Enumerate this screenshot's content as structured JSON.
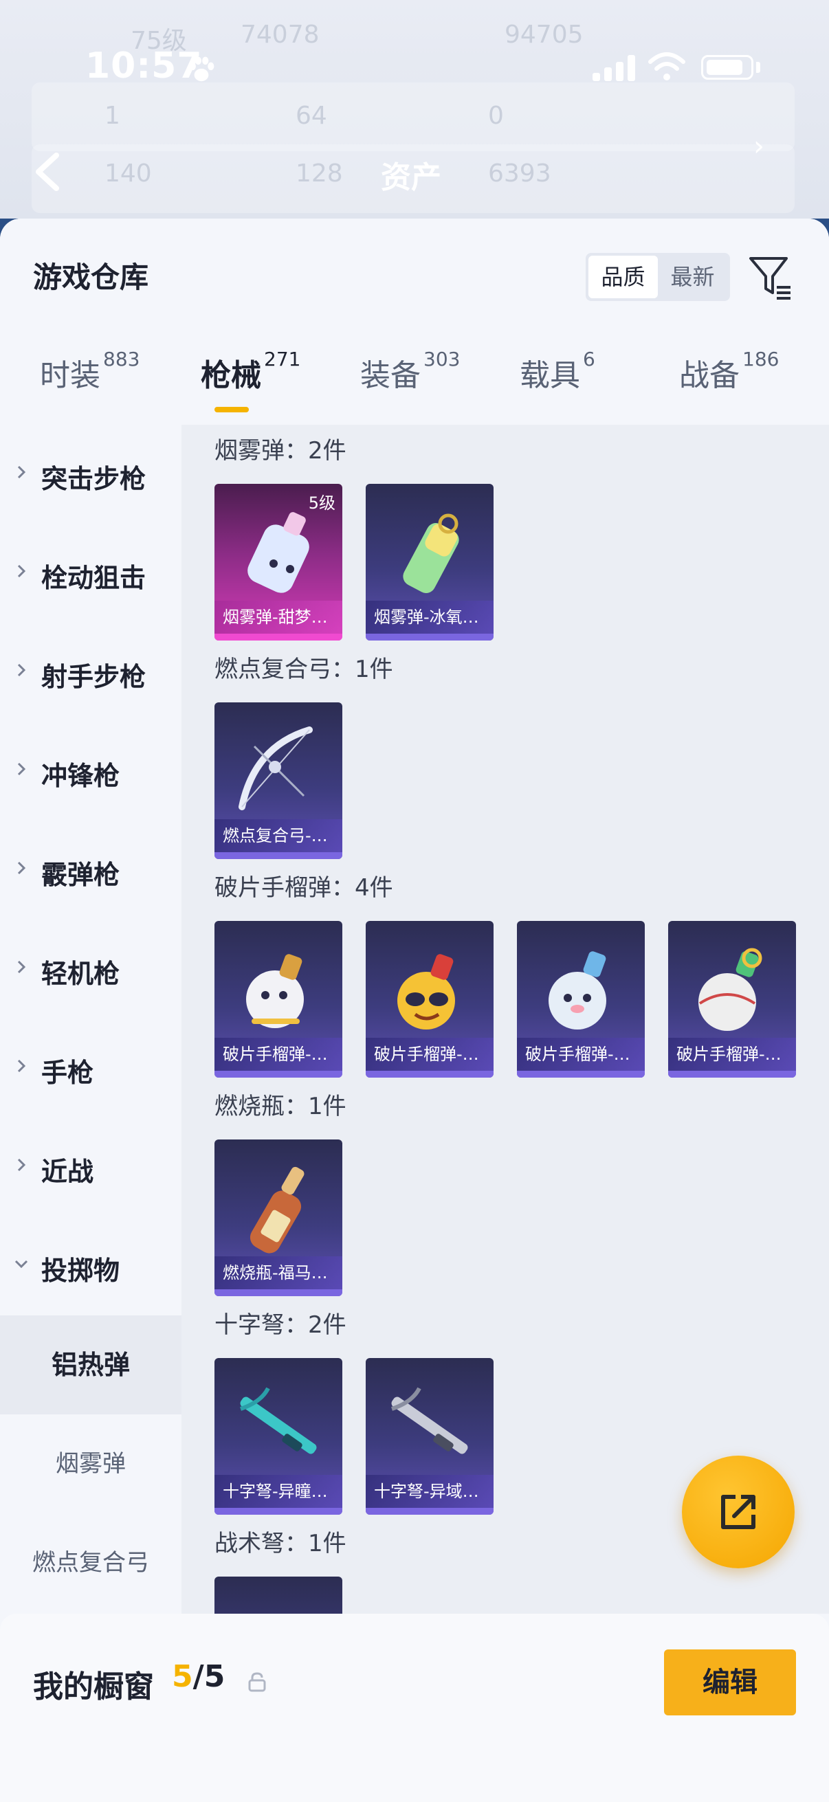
{
  "status_bar": {
    "time": "10:57"
  },
  "nav": {
    "title": "资产"
  },
  "background_stats": [
    "75级",
    "74078",
    "94705",
    "1",
    "64",
    "0",
    "140",
    "128",
    "6393"
  ],
  "sheet": {
    "title": "游戏仓库",
    "sort_options": [
      {
        "label": "品质",
        "active": true
      },
      {
        "label": "最新",
        "active": false
      }
    ]
  },
  "tabs": [
    {
      "label": "时装",
      "count": "883",
      "active": false
    },
    {
      "label": "枪械",
      "count": "271",
      "active": true
    },
    {
      "label": "装备",
      "count": "303",
      "active": false
    },
    {
      "label": "载具",
      "count": "6",
      "active": false
    },
    {
      "label": "战备",
      "count": "186",
      "active": false
    }
  ],
  "sidebar": {
    "categories": [
      {
        "label": "突击步枪",
        "expanded": false
      },
      {
        "label": "栓动狙击",
        "expanded": false
      },
      {
        "label": "射手步枪",
        "expanded": false
      },
      {
        "label": "冲锋枪",
        "expanded": false
      },
      {
        "label": "霰弹枪",
        "expanded": false
      },
      {
        "label": "轻机枪",
        "expanded": false
      },
      {
        "label": "手枪",
        "expanded": false
      },
      {
        "label": "近战",
        "expanded": false
      },
      {
        "label": "投掷物",
        "expanded": true
      }
    ],
    "subcategories": [
      {
        "label": "铝热弹",
        "active": true
      },
      {
        "label": "烟雾弹",
        "active": false
      },
      {
        "label": "燃点复合弓",
        "active": false
      }
    ]
  },
  "sections": [
    {
      "title": "烟雾弹：2件",
      "items": [
        {
          "name": "烟雾弹-甜梦…",
          "level": "5级",
          "rarity": "pink",
          "icon": "smoke-bottle-icon"
        },
        {
          "name": "烟雾弹-冰氧…",
          "level": "",
          "rarity": "purple",
          "icon": "smoke-canister-icon"
        }
      ]
    },
    {
      "title": "燃点复合弓：1件",
      "items": [
        {
          "name": "燃点复合弓-…",
          "level": "",
          "rarity": "purple",
          "icon": "bow-icon"
        }
      ]
    },
    {
      "title": "破片手榴弹：4件",
      "items": [
        {
          "name": "破片手榴弹-…",
          "level": "",
          "rarity": "purple",
          "icon": "grenade-icon"
        },
        {
          "name": "破片手榴弹-…",
          "level": "",
          "rarity": "purple",
          "icon": "grenade-icon"
        },
        {
          "name": "破片手榴弹-…",
          "level": "",
          "rarity": "purple",
          "icon": "grenade-icon"
        },
        {
          "name": "破片手榴弹-…",
          "level": "",
          "rarity": "purple",
          "icon": "grenade-icon"
        }
      ]
    },
    {
      "title": "燃烧瓶：1件",
      "items": [
        {
          "name": "燃烧瓶-福马…",
          "level": "",
          "rarity": "purple",
          "icon": "molotov-icon"
        }
      ]
    },
    {
      "title": "十字弩：2件",
      "items": [
        {
          "name": "十字弩-异瞳…",
          "level": "",
          "rarity": "purple",
          "icon": "crossbow-icon"
        },
        {
          "name": "十字弩-异域…",
          "level": "",
          "rarity": "purple",
          "icon": "crossbow-icon"
        }
      ]
    },
    {
      "title": "战术弩：1件",
      "items": [
        {
          "name": "",
          "level": "",
          "rarity": "purple",
          "icon": "crossbow-icon"
        }
      ]
    }
  ],
  "bottom_bar": {
    "title": "我的橱窗",
    "current": "5",
    "separator": "/",
    "total": "5",
    "edit_label": "编辑"
  },
  "colors": {
    "accent": "#f5b300",
    "rare_purple": "#7a66e0",
    "rare_pink": "#f04ad0"
  }
}
